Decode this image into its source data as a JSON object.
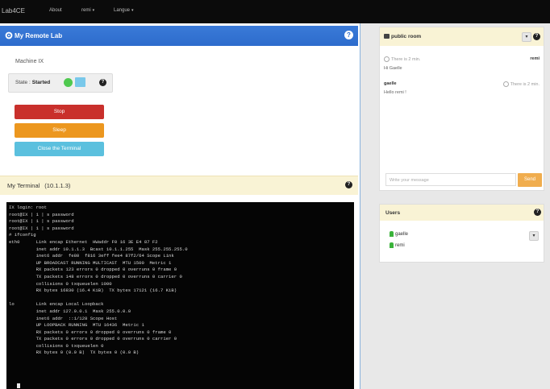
{
  "navbar": {
    "brand": "Lab4CE",
    "items": [
      {
        "label": "About",
        "caret": false
      },
      {
        "label": "remi",
        "caret": true
      },
      {
        "label": "Langue",
        "caret": true
      }
    ],
    "caret": "▾"
  },
  "remote_lab": {
    "title": "My Remote Lab",
    "help": "?",
    "machine_label": "Machine IX",
    "state_label": "State :",
    "state_value": "Started",
    "status_color": "#4fc94f",
    "buttons": {
      "stop": "Stop",
      "sleep": "Sleep",
      "close_terminal": "Close the Terminal"
    }
  },
  "terminal": {
    "title": "My Terminal",
    "ip": "(10.1.1.3)",
    "help": "?",
    "lines": [
      "IX login: root",
      "root@IX | 1 | s password",
      "root@IX | 1 | s password",
      "root@IX | 1 | s password",
      "# ifconfig",
      "eth0      Link encap Ethernet  HWaddr F0 16 3E E4 87 F2",
      "          inet addr 10.1.1.3  Bcast 10.1.1.255  Mask 255.255.255.0",
      "          inet6 addr  fe80  f816 3eff fee4 87f2/64 Scope Link",
      "          UP BROADCAST RUNNING MULTICAST  MTU 1500  Metric 1",
      "          RX packets 123 errors 0 dropped 0 overruns 0 frame 0",
      "          TX packets 148 errors 0 dropped 0 overruns 0 carrier 0",
      "          collisions 0 txqueuelen 1000",
      "          RX bytes 16830 (16.4 KiB)  TX bytes 17121 (16.7 KiB)",
      "",
      "lo        Link encap Local Loopback",
      "          inet addr 127.0.0.1  Mask 255.0.0.0",
      "          inet6 addr  ::1/128 Scope Host",
      "          UP LOOPBACK RUNNING  MTU 16436  Metric 1",
      "          RX packets 0 errors 0 dropped 0 overruns 0 frame 0",
      "          TX packets 0 errors 0 dropped 0 overruns 0 carrier 0",
      "          collisions 0 txqueuelen 0",
      "          RX bytes 0 (0.0 B)  TX bytes 0 (0.0 B)"
    ]
  },
  "chat": {
    "title": "public room",
    "help": "?",
    "chevron": "▾",
    "messages": [
      {
        "author": "remi",
        "time": "There is 2 min.",
        "text": "Hi Gaelle"
      },
      {
        "author": "gaelle",
        "time": "There is 2 min.",
        "text": "Hello remi !"
      }
    ],
    "input_placeholder": "Write your message",
    "send_label": "Send"
  },
  "users": {
    "title": "Users",
    "help": "?",
    "chevron": "▾",
    "list": [
      {
        "name": "gaelle"
      },
      {
        "name": "remi"
      }
    ]
  },
  "colors": {
    "navbar": "#0b0b0b",
    "lab_header": "#2d6ccc",
    "panel_header": "#f9f3d5",
    "stop": "#c9302c",
    "sleep": "#ec971f",
    "close_terminal": "#5bc0de",
    "send": "#f0ad4e",
    "user_online": "#3bb33b"
  },
  "icons": {
    "lab": "gear-icon",
    "chat": "comment-icon",
    "clock": "clock-icon",
    "user": "user-icon",
    "help": "question-circle-icon"
  }
}
